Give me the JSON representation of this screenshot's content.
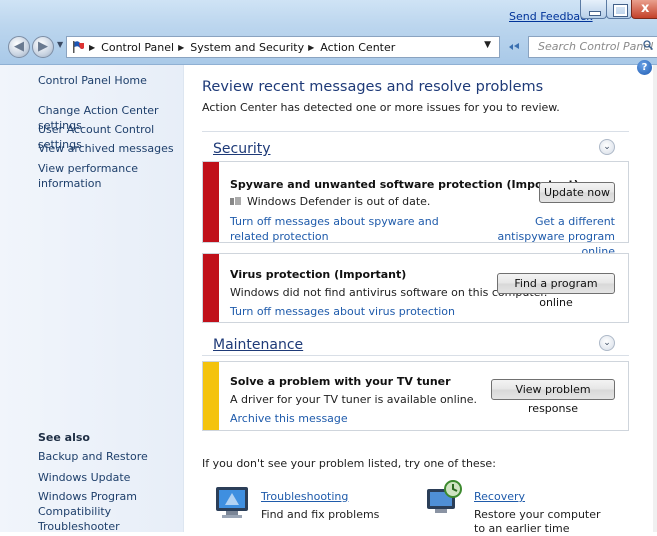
{
  "window": {
    "send_feedback": "Send Feedback",
    "close_glyph": "x"
  },
  "address": {
    "crumbs": [
      "Control Panel",
      "System and Security",
      "Action Center"
    ],
    "search_placeholder": "Search Control Panel"
  },
  "sidebar": {
    "items": [
      "Control Panel Home",
      "Change Action Center settings",
      "User Account Control settings",
      "View archived messages",
      "View performance information"
    ],
    "see_also_title": "See also",
    "see_also": [
      "Backup and Restore",
      "Windows Update",
      "Windows Program Compatibility Troubleshooter"
    ]
  },
  "main": {
    "title": "Review recent messages and resolve problems",
    "subtitle": "Action Center has detected one or more issues for you to review.",
    "security": {
      "heading": "Security",
      "items": [
        {
          "title": "Spyware and unwanted software protection  (Important)",
          "status": "Windows Defender is out of date.",
          "button": "Update now",
          "link_left": "Turn off messages about spyware and related protection",
          "link_right": "Get a different antispyware program online",
          "severity_color": "#c0101a"
        },
        {
          "title": "Virus protection  (Important)",
          "status": "Windows did not find antivirus software on this computer.",
          "button": "Find a program online",
          "link_left": "Turn off messages about virus protection",
          "severity_color": "#c0101a"
        }
      ]
    },
    "maintenance": {
      "heading": "Maintenance",
      "items": [
        {
          "title": "Solve a problem with your TV tuner",
          "status": "A driver for your TV tuner is available online.",
          "button": "View problem response",
          "link_left": "Archive this message",
          "severity_color": "#f4c30e"
        }
      ]
    },
    "nolist_text": "If you don't see your problem listed, try one of these:",
    "tools": [
      {
        "title": "Troubleshooting",
        "desc": "Find and fix problems",
        "icon": "troubleshooting-icon"
      },
      {
        "title": "Recovery",
        "desc": "Restore your computer to an earlier time",
        "icon": "recovery-icon"
      }
    ]
  },
  "icons": {
    "help": "?",
    "chevron": "⌄"
  }
}
